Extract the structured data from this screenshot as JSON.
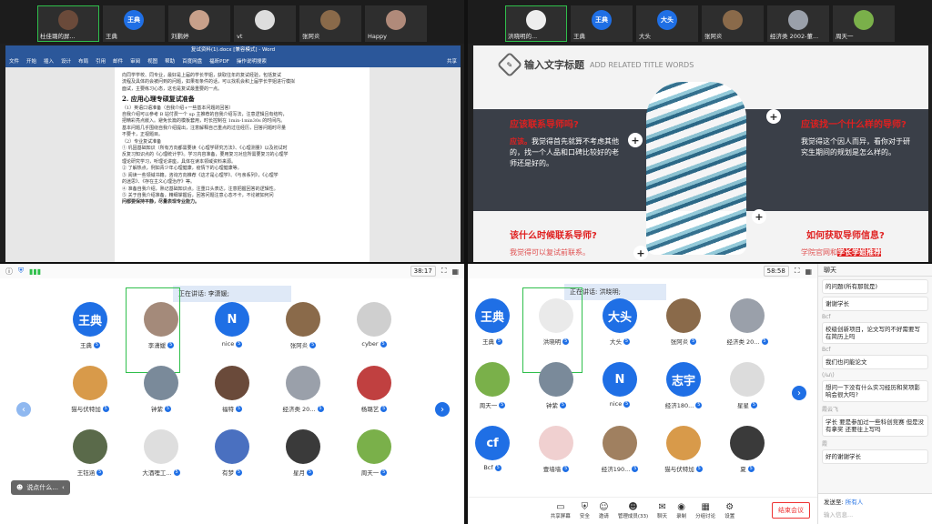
{
  "q1": {
    "tiles": [
      {
        "name": "杜佳璐的屏...",
        "initial": "",
        "speaking": true
      },
      {
        "name": "王典",
        "initial": "王典",
        "speaking": false
      },
      {
        "name": "刘鹏婷",
        "initial": "",
        "speaking": false
      },
      {
        "name": "vt",
        "initial": "",
        "speaking": false
      },
      {
        "name": "张阿炎",
        "initial": "",
        "speaking": false
      },
      {
        "name": "Happy",
        "initial": "",
        "speaking": false
      }
    ],
    "word": {
      "title": "复试资料(1).docx [兼容模式] - Word",
      "ribbon": [
        "文件",
        "开始",
        "插入",
        "设计",
        "布局",
        "引用",
        "邮件",
        "审阅",
        "视图",
        "帮助",
        "百度网盘",
        "福昕PDF",
        "操作说明搜索"
      ],
      "share": "共享",
      "lines": [
        "向同学学校、同专业，最好是上届的学长学姐，获取往年的复试经验，包括复试",
        "流程及具体的会被问到的问题，如果有条件的话，可以找机会和上届学长学姐进行模拟",
        "面试，主要练习心态，这也是复试最重要的一点。"
      ],
      "heading": "2. 应用心理专硕复试准备",
      "body": [
        "（1）英语口语准备（自我介绍+一些基本问题的回答）",
        "自我介绍可以参考 B 站付费一个 up 主推荐的自我介绍写法，注意逻辑且有结构，",
        "把精彩亮点嵌入。避免长篇的模板套用，时长控制在 1min-1min30s 的时间内。",
        "基本问题几乎围绕自我介绍提出，注意解释自己重点的过往经历，回答问题时尽量",
        "不要卡，正视题目。",
        "（2）专业复试准备",
        "①  巩固基础知识（所有方向都需要读《心理学研究方法》、《心理测量》以及初试时",
        "    反复习知识点的《心理统计学》。学习内容准备，要用复习对应所需要复习的心理学",
        "    理论研究学习，听理论讲座，具体在读本领域资料来源。",
        "②  了解热点，例如青少年心理健康，疫情下的心理健康等。",
        "③  阅读一些领域书籍，咨询方向推荐《这才是心理学》、《与亲系列》，《心理学",
        "    的迷思》、《存在主义心理治疗》等。",
        "④  准备自我介绍，熟记基础知识点。注重口头表达，注意把握回答的逻辑性。",
        "⑤  关于自我介绍准备，精细掌握后，回答问题注意心态不卡，不论被如何问",
        "    问都要保持平静，尽量表现专业能力。"
      ]
    }
  },
  "q1bar": {
    "timer": "38:17"
  },
  "q2": {
    "tiles": [
      {
        "name": "洪晓明的...",
        "initial": "",
        "speaking": true
      },
      {
        "name": "王典",
        "initial": "王典",
        "speaking": false
      },
      {
        "name": "大头",
        "initial": "大头",
        "speaking": false
      },
      {
        "name": "张阿炎",
        "initial": "",
        "speaking": false
      },
      {
        "name": "经济类 2002-董...",
        "initial": "",
        "speaking": false
      },
      {
        "name": "周天一",
        "initial": "",
        "speaking": false
      }
    ],
    "slide": {
      "title": "输入文字标题",
      "subtitle": "ADD RELATED TITLE WORDS",
      "q_left1": "应该联系导师吗?",
      "a_left1_key": "应该。",
      "a_left1": "我觉得首先就算不考虑其他的，找一个人品和口碑比较好的老师还是好的。",
      "q_right1": "应该找一个什么样的导师?",
      "a_right1": "我觉得这个因人而异，看你对于研究生期间的规划是怎么样的。",
      "q_left2": "该什么时候联系导师?",
      "a_left2": "我觉得可以复试前联系。",
      "q_right2": "如何获取导师信息?",
      "a_right2_a": "学院官网和",
      "a_right2_b": "学长学姐推荐"
    }
  },
  "q3": {
    "timer": "38:17",
    "talking": "正在讲话: 李潇媛;",
    "badge": "5",
    "pill": "说点什么...",
    "people": [
      {
        "name": "王典",
        "initial": "王典",
        "color": "#1f6fe5"
      },
      {
        "name": "李潇媛",
        "initial": "",
        "color": "#a48a7a"
      },
      {
        "name": "nice",
        "initial": "N",
        "color": "#1f6fe5"
      },
      {
        "name": "张阿炎",
        "initial": "",
        "color": "#8a6a4a"
      },
      {
        "name": "cyber",
        "initial": "",
        "color": "#cfcfcf"
      },
      {
        "name": "猫与伏特加",
        "initial": "",
        "color": "#d89a4a"
      },
      {
        "name": "钟紫",
        "initial": "",
        "color": "#7a8a9a"
      },
      {
        "name": "福特",
        "initial": "",
        "color": "#6a4a3a"
      },
      {
        "name": "经济类 20...",
        "initial": "",
        "color": "#9aa0aa"
      },
      {
        "name": "杨璐艺",
        "initial": "",
        "color": "#c04040"
      },
      {
        "name": "王钰涵",
        "initial": "",
        "color": "#5a6a4a"
      },
      {
        "name": "大酒哩工...",
        "initial": "",
        "color": "#dedede"
      },
      {
        "name": "有梦",
        "initial": "",
        "color": "#4a70c0"
      },
      {
        "name": "星月",
        "initial": "",
        "color": "#3a3a3a"
      },
      {
        "name": "周天一",
        "initial": "",
        "color": "#7ab04a"
      }
    ]
  },
  "q4": {
    "timer": "58:58",
    "talking": "正在讲话: 洪晓明;",
    "people": [
      {
        "name": "王典",
        "initial": "王典",
        "color": "#1f6fe5"
      },
      {
        "name": "洪晓明",
        "initial": "",
        "color": "#eaeaea"
      },
      {
        "name": "大头",
        "initial": "大头",
        "color": "#1f6fe5"
      },
      {
        "name": "张阿炎",
        "initial": "",
        "color": "#8a6a4a"
      },
      {
        "name": "经济类 20...",
        "initial": "",
        "color": "#9aa0aa"
      },
      {
        "name": "周天一",
        "initial": "",
        "color": "#7ab04a"
      },
      {
        "name": "钟紫",
        "initial": "",
        "color": "#7a8a9a"
      },
      {
        "name": "nice",
        "initial": "N",
        "color": "#1f6fe5"
      },
      {
        "name": "经济180...",
        "initial": "志宇",
        "color": "#1f6fe5"
      },
      {
        "name": "星星",
        "initial": "",
        "color": "#dcdcdc"
      },
      {
        "name": "Bcf",
        "initial": "cf",
        "color": "#1f6fe5"
      },
      {
        "name": "壹墙墙",
        "initial": "",
        "color": "#f0d0d0"
      },
      {
        "name": "经济190...",
        "initial": "",
        "color": "#a08060"
      },
      {
        "name": "猫与伏特加",
        "initial": "",
        "color": "#d89a4a"
      },
      {
        "name": "夏",
        "initial": "",
        "color": "#3a3a3a"
      }
    ],
    "toolbar": [
      "共享屏幕",
      "安全",
      "邀请",
      "管理成员(33)",
      "聊天",
      "录制",
      "分组讨论",
      "设置"
    ],
    "end": "结束会议",
    "chat": {
      "title": "聊天",
      "msgs": [
        {
          "who": "",
          "text": "的问题(所有那就是)"
        },
        {
          "who": "",
          "text": "谢谢学长"
        },
        {
          "who": "Bcf",
          "text": "校级创新项目，论文写的不好需要写在简历上吗"
        },
        {
          "who": "Bcf",
          "text": "我们也问能论文"
        },
        {
          "who": "(/ω\\)",
          "text": "想问一下没有什么实习经历和奖项影响会很大吗?"
        },
        {
          "who": "霞云飞",
          "text": "学长 要是参加过一些科创竞赛 但是没有拿奖 还要往上写吗"
        },
        {
          "who": "霞",
          "text": "好的谢谢学长"
        }
      ],
      "send_to": "发送至:",
      "send_target": "所有人",
      "placeholder": "输入信息..."
    }
  }
}
